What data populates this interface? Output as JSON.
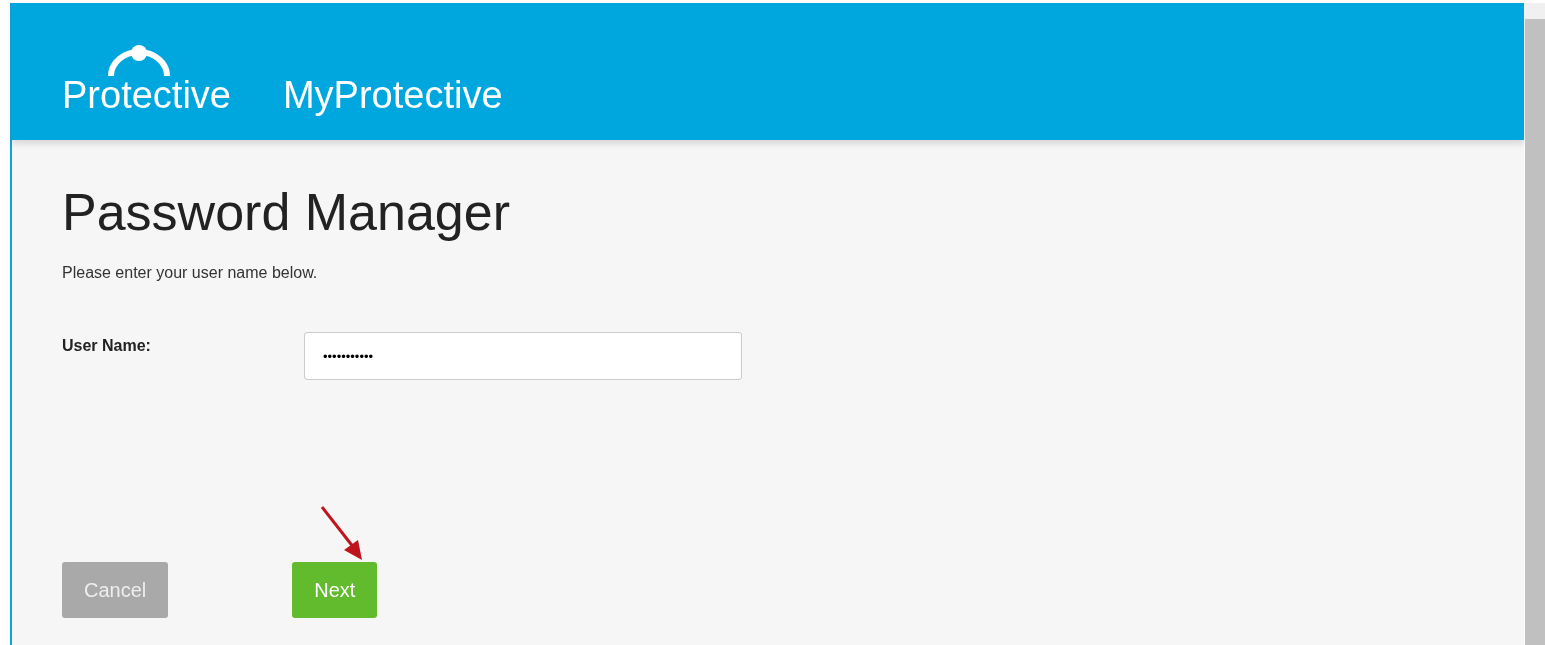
{
  "header": {
    "brand": "Protective",
    "site_title": "MyProtective"
  },
  "page": {
    "title": "Password Manager",
    "instruction": "Please enter your user name below."
  },
  "form": {
    "fields": [
      {
        "label": "User Name:",
        "value": "•••••••••••"
      }
    ]
  },
  "buttons": [
    {
      "label": "Cancel",
      "kind": "secondary",
      "disabled": true
    },
    {
      "label": "Next",
      "kind": "primary",
      "disabled": false
    }
  ]
}
